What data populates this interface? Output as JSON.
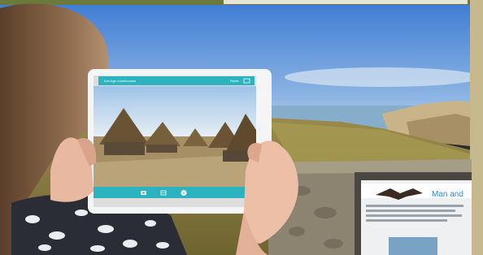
{
  "scene": {
    "tablet_app_bar_title": "Iron Age roundhouses",
    "tablet_app_bar_action": "Reset",
    "sign_heading": "Man and",
    "colors": {
      "sky_top": "#3f7fd6",
      "sky_bottom": "#bcd6ec",
      "sea": "#7fa9c8",
      "grass": "#8a8a45",
      "app_bar": "#2bb3c0",
      "stone_wall": "#8c8470"
    },
    "icons": [
      "camera-icon",
      "grid-icon",
      "info-icon"
    ]
  }
}
